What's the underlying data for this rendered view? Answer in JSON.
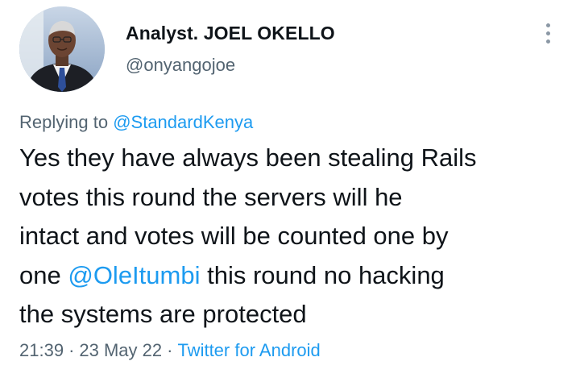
{
  "author": {
    "display_name": "Analyst. JOEL OKELLO",
    "handle": "@onyangojoe",
    "avatar_icon": "profile-photo"
  },
  "more_icon": "more-vertical-icon",
  "reply": {
    "prefix": "Replying to",
    "to_handle": "@StandardKenya"
  },
  "body": {
    "line1": "Yes they have always been stealing Rails",
    "line2": "votes this round the servers will he",
    "line3": "intact and votes will be counted one by",
    "line4_pre": "one ",
    "line4_mention": "@OleItumbi",
    "line4_post": " this round no hacking",
    "line5": "the systems are protected"
  },
  "meta": {
    "time": "21:39",
    "separator": "·",
    "date": "23 May 22",
    "source": "Twitter for Android"
  },
  "colors": {
    "link": "#1d9bf0",
    "secondary_text": "#536471",
    "primary_text": "#0f1419"
  }
}
